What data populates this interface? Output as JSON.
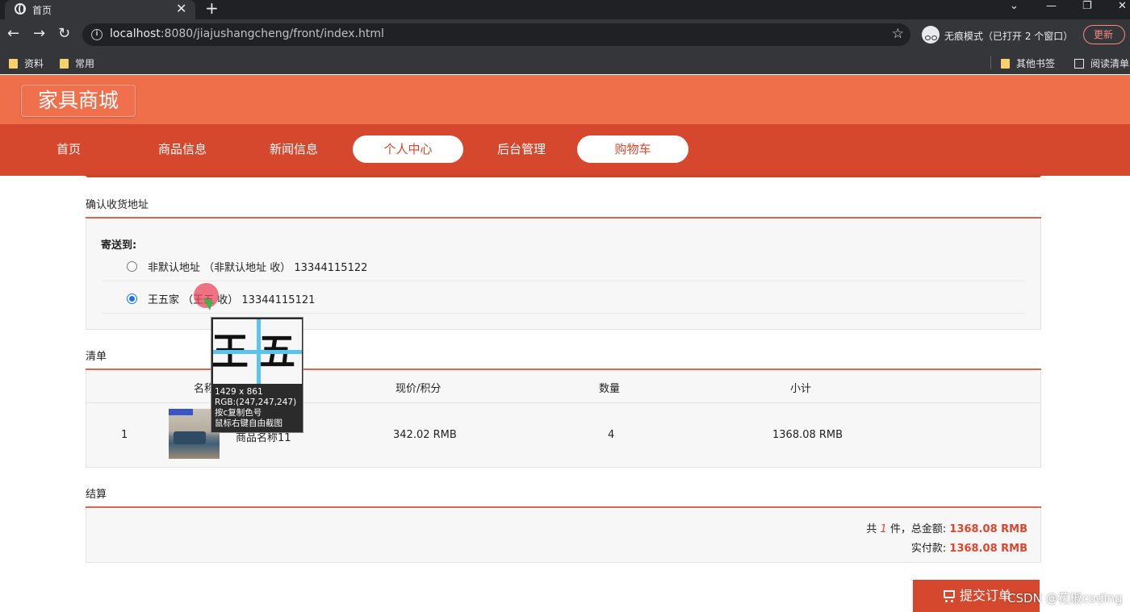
{
  "browser": {
    "tab_title": "首页",
    "tab_close": "✕",
    "new_tab": "+",
    "url_host": "localhost",
    "url_rest": ":8080/jiajushangcheng/front/index.html",
    "incognito_label": "无痕模式（已打开 2 个窗口）",
    "update_label": "更新",
    "bookmarks": [
      "资料",
      "常用"
    ],
    "other_bookmarks": "其他书签",
    "reading_list": "阅读清单"
  },
  "site": {
    "logo": "家具商城",
    "nav": [
      {
        "label": "首页"
      },
      {
        "label": "商品信息"
      },
      {
        "label": "新闻信息"
      },
      {
        "label": "个人中心"
      },
      {
        "label": "后台管理"
      },
      {
        "label": "购物车"
      }
    ]
  },
  "address": {
    "section_title": "确认收货地址",
    "ship_to_label": "寄送到:",
    "options": [
      {
        "text": "非默认地址 （非默认地址 收） 13344115122",
        "selected": false
      },
      {
        "text": "王五家 （王五 收） 13344115121",
        "selected": true
      }
    ]
  },
  "list": {
    "section_title": "清单",
    "headers": {
      "name": "名称",
      "price": "现价/积分",
      "qty": "数量",
      "subtotal": "小计"
    },
    "rows": [
      {
        "index": "1",
        "name": "商品名称11",
        "price": "342.02 RMB",
        "qty": "4",
        "subtotal": "1368.08 RMB"
      }
    ]
  },
  "checkout": {
    "section_title": "结算",
    "total_prefix": "共",
    "total_count": "1",
    "total_mid": "件，总金额:",
    "total_amount": "1368.08 RMB",
    "paid_label": "实付款:",
    "paid_amount": "1368.08 RMB",
    "submit_label": "提交订单"
  },
  "magnifier": {
    "glyph_a": "王",
    "glyph_b": "五",
    "size": "1429 x 861",
    "rgb": "RGB:(247,247,247)",
    "hint1": "按c复制色号",
    "hint2": "鼠标右键自由截图"
  },
  "watermark": "CSDN @花椒coding",
  "colors": {
    "header": "#ef6f4b",
    "nav": "#d5482e",
    "accent_red": "#e0452a"
  }
}
